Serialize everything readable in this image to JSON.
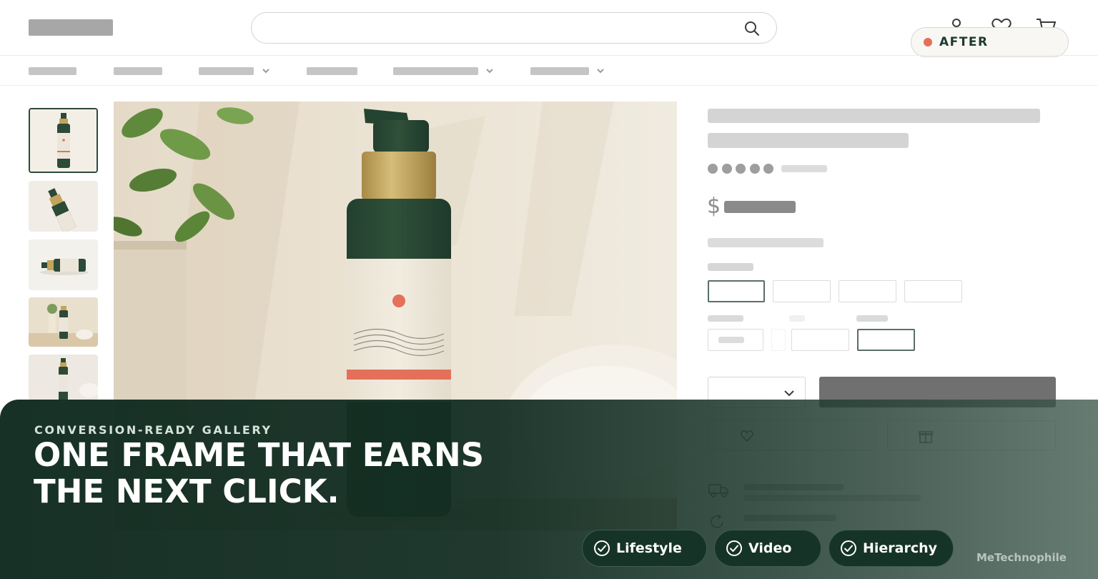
{
  "header": {
    "search": {
      "value": "",
      "placeholder": ""
    },
    "icons": [
      "search-icon",
      "account-icon",
      "wishlist-heart-icon",
      "cart-icon"
    ],
    "badge": {
      "label": "AFTER",
      "dot_color": "#e4705a"
    }
  },
  "nav": {
    "items": [
      {
        "has_dropdown": false
      },
      {
        "has_dropdown": false
      },
      {
        "has_dropdown": true
      },
      {
        "has_dropdown": false
      },
      {
        "has_dropdown": true
      },
      {
        "has_dropdown": true
      }
    ]
  },
  "gallery": {
    "thumbnails": [
      {
        "subject": "bottle-front",
        "selected": true
      },
      {
        "subject": "bottle-tilted",
        "selected": false
      },
      {
        "subject": "bottle-lying",
        "selected": false
      },
      {
        "subject": "lifestyle-shelf",
        "selected": false
      },
      {
        "subject": "bottle-with-towel",
        "selected": false
      }
    ],
    "main_image": "green pump bottle with cream label and coral dot beside a potted plant"
  },
  "product": {
    "currency_symbol": "$",
    "rating_dots": 5,
    "icons": [
      "chevron-down-icon",
      "heart-icon",
      "gift-icon",
      "truck-icon",
      "return-icon"
    ]
  },
  "overlay": {
    "eyebrow": "CONVERSION-READY GALLERY",
    "headline_line1": "ONE FRAME THAT EARNS",
    "headline_line2": "THE NEXT CLICK.",
    "chips": [
      {
        "label": "Lifestyle",
        "icon": "check-circle-icon"
      },
      {
        "label": "Video",
        "icon": "check-circle-icon"
      },
      {
        "label": "Hierarchy",
        "icon": "check-circle-icon"
      }
    ],
    "watermark": "MeTechnophile"
  },
  "colors": {
    "brand_green": "#1e3a2e",
    "accent_coral": "#e4705a",
    "bottle_green": "#2c4a37",
    "gold_collar": "#c4a45a"
  }
}
